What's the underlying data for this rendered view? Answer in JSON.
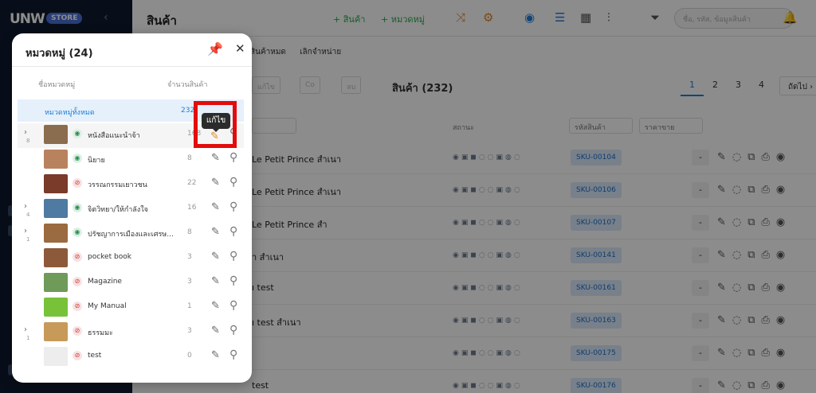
{
  "sidebar": {
    "logo": "UNW",
    "store_badge": "STORE",
    "collapse_icon": "chevron-left-icon"
  },
  "header": {
    "title": "สินค้า",
    "add_product": "+ สินค้า",
    "add_category": "+ หมวดหมู่",
    "search_placeholder": "ชื่อ, รหัส, ข้อมูลสินค้า"
  },
  "subtabs": [
    "สินค้าหมด",
    "เลิกจำหน่าย"
  ],
  "toolbar": {
    "edit_label": "แก้ไข",
    "copy_label": "Co",
    "delete_label": "ลบ",
    "product_count": "สินค้า (232)",
    "pages": [
      "1",
      "2",
      "3",
      "4"
    ],
    "next_label": "ถัดไป ›"
  },
  "filters": {
    "status": "สถานะ",
    "sku": "รหัสสินค้า",
    "price": "ราคาขาย"
  },
  "products": [
    {
      "name": "Le Petit Prince สำเนา",
      "sku": "SKU-00104"
    },
    {
      "name": "Le Petit Prince สำเนา",
      "sku": "SKU-00106"
    },
    {
      "name": "Le Petit Prince สำ",
      "sku": "SKU-00107"
    },
    {
      "name": "า สำเนา",
      "sku": "SKU-00141"
    },
    {
      "name": "ı test",
      "sku": "SKU-00161"
    },
    {
      "name": "ı test สำเนา",
      "sku": "SKU-00163"
    },
    {
      "name": "",
      "sku": "SKU-00175"
    },
    {
      "name": "test",
      "sku": "SKU-00176"
    }
  ],
  "modal": {
    "title": "หมวดหมู่ (24)",
    "col_name": "ชื่อหมวดหมู่",
    "col_count": "จำนวนสินค้า",
    "all_label": "หมวดหมู่ทั้งหมด",
    "all_count": "232",
    "tooltip": "แก้ไข",
    "categories": [
      {
        "name": "หนังสือแนะนำจ้า",
        "count": "168",
        "visible": true,
        "expandable": true,
        "sub": "8",
        "thumb": "#8a6d4e"
      },
      {
        "name": "นิยาย",
        "count": "8",
        "visible": true,
        "expandable": false,
        "sub": "",
        "thumb": "#b9825e"
      },
      {
        "name": "วรรณกรรมเยาวชน",
        "count": "22",
        "visible": false,
        "expandable": false,
        "sub": "",
        "thumb": "#7a3b2a"
      },
      {
        "name": "จิตวิทยา/ให้กำลังใจ",
        "count": "16",
        "visible": true,
        "expandable": true,
        "sub": "4",
        "thumb": "#4f7aa2"
      },
      {
        "name": "ปรัชญาการเมืองและเศรษ...",
        "count": "8",
        "visible": true,
        "expandable": true,
        "sub": "1",
        "thumb": "#9a6a40"
      },
      {
        "name": "pocket book",
        "count": "3",
        "visible": false,
        "expandable": false,
        "sub": "",
        "thumb": "#8c5a3a"
      },
      {
        "name": "Magazine",
        "count": "3",
        "visible": false,
        "expandable": false,
        "sub": "",
        "thumb": "#6e9a5a"
      },
      {
        "name": "My Manual",
        "count": "1",
        "visible": false,
        "expandable": false,
        "sub": "",
        "thumb": "#78c23a"
      },
      {
        "name": "ธรรมมะ",
        "count": "3",
        "visible": false,
        "expandable": true,
        "sub": "1",
        "thumb": "#c89a5a"
      },
      {
        "name": "test",
        "count": "0",
        "visible": false,
        "expandable": false,
        "sub": "",
        "thumb": "#ededed"
      }
    ]
  },
  "colors": {
    "accent": "#1e7fd8",
    "add_green": "#2fa84f",
    "highlight_red": "#e30b0b",
    "sidebar_bg": "#0f1a2e"
  }
}
